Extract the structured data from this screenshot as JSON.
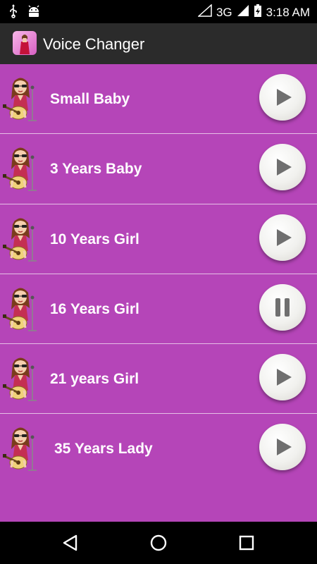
{
  "status_bar": {
    "network": "3G",
    "time": "3:18 AM",
    "icons": [
      "usb-icon",
      "android-icon",
      "wifi-icon",
      "signal-icon",
      "battery-charging-icon"
    ]
  },
  "action_bar": {
    "title": "Voice Changer",
    "icon": "app-icon"
  },
  "items": [
    {
      "label": "Small Baby",
      "state": "play"
    },
    {
      "label": "3 Years Baby",
      "state": "play"
    },
    {
      "label": "10 Years Girl",
      "state": "play"
    },
    {
      "label": "16 Years Girl",
      "state": "pause"
    },
    {
      "label": "21 years Girl",
      "state": "play"
    },
    {
      "label": "35 Years Lady",
      "state": "play"
    }
  ],
  "nav_bar": {
    "icons": [
      "back-icon",
      "home-icon",
      "recents-icon"
    ]
  },
  "colors": {
    "background": "#b545b8",
    "action_bar": "#2b2b2b",
    "divider": "#e6bfe6"
  }
}
